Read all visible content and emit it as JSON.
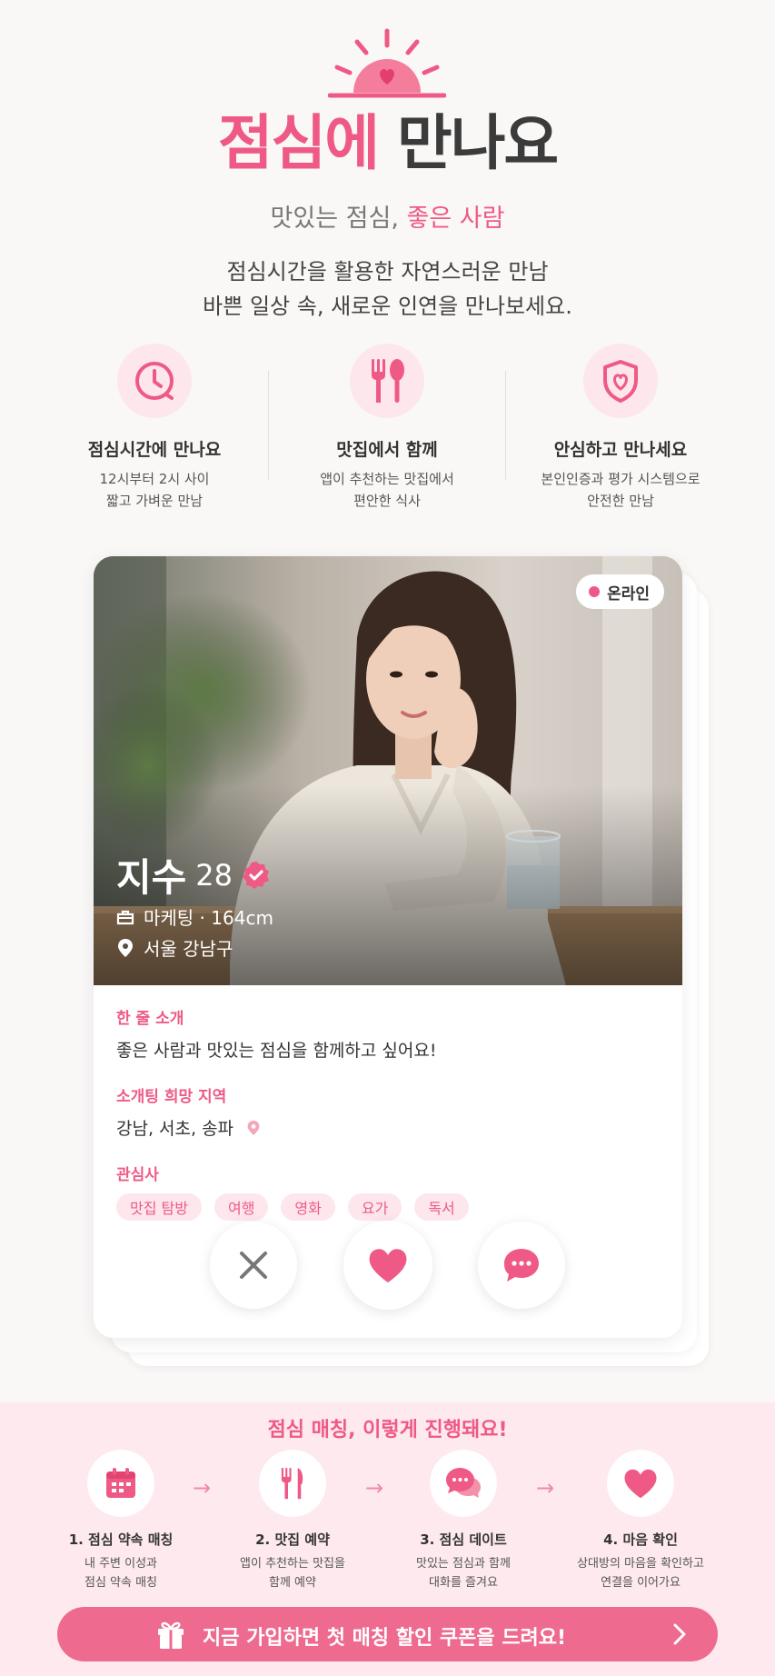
{
  "hero": {
    "title_pink": "점심에",
    "title_dark": "만나요",
    "subtitle_gray": "맛있는 점심,",
    "subtitle_pink": "좋은 사람",
    "desc_line1": "점심시간을 활용한 자연스러운 만남",
    "desc_line2": "바쁜 일상 속, 새로운 인연을 만나보세요."
  },
  "features": [
    {
      "icon": "clock-icon",
      "title": "점심시간에 만나요",
      "desc1": "12시부터 2시 사이",
      "desc2": "짧고 가벼운 만남"
    },
    {
      "icon": "utensils-icon",
      "title": "맛집에서 함께",
      "desc1": "앱이 추천하는 맛집에서",
      "desc2": "편안한 식사"
    },
    {
      "icon": "shield-heart-icon",
      "title": "안심하고 만나세요",
      "desc1": "본인인증과 평가 시스템으로",
      "desc2": "안전한 만남"
    }
  ],
  "profile": {
    "status": "온라인",
    "name": "지수",
    "age": "28",
    "job_height": "마케팅 · 164cm",
    "location": "서울 강남구",
    "intro_label": "한 줄 소개",
    "intro_text": "좋은 사람과 맛있는 점심을 함께하고 싶어요!",
    "region_label": "소개팅 희망 지역",
    "region_text": "강남, 서초, 송파",
    "interests_label": "관심사",
    "interests": [
      "맛집 탐방",
      "여행",
      "영화",
      "요가",
      "독서"
    ]
  },
  "process": {
    "title": "점심 매칭, 이렇게 진행돼요!",
    "steps": [
      {
        "icon": "calendar-icon",
        "title": "1. 점심 약속 매칭",
        "desc1": "내 주변 이성과",
        "desc2": "점심 약속 매칭"
      },
      {
        "icon": "utensils-icon",
        "title": "2. 맛집 예약",
        "desc1": "앱이 추천하는 맛집을",
        "desc2": "함께 예약"
      },
      {
        "icon": "chat-bubbles-icon",
        "title": "3. 점심 데이트",
        "desc1": "맛있는 점심과 함께",
        "desc2": "대화를 즐겨요"
      },
      {
        "icon": "heart-icon",
        "title": "4. 마음 확인",
        "desc1": "상대방의 마음을 확인하고",
        "desc2": "연결을 이어가요"
      }
    ],
    "cta": "지금 가입하면 첫 매칭 할인 쿠폰을 드려요!"
  },
  "colors": {
    "accent": "#ee5a85",
    "accent_light": "#fde6ec",
    "cta": "#ee6b8f"
  }
}
